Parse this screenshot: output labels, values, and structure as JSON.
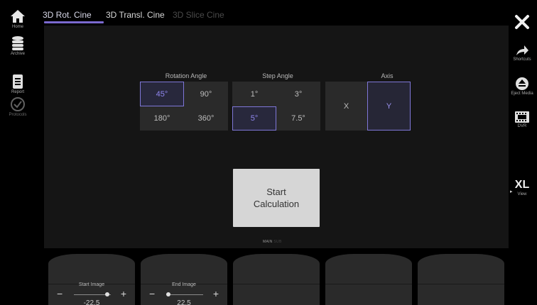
{
  "sidebar_left": {
    "home": "Home",
    "archive": "Archive",
    "report": "Report",
    "protocols": "Protocols"
  },
  "sidebar_right": {
    "shortcuts": "Shortcuts",
    "eject": "Eject Media",
    "dvr": "DVR",
    "xl": "XL",
    "view": "View"
  },
  "tabs": [
    {
      "label": "3D Rot. Cine",
      "state": "active"
    },
    {
      "label": "3D Transl. Cine",
      "state": "normal"
    },
    {
      "label": "3D Slice Cine",
      "state": "disabled"
    }
  ],
  "rotation": {
    "label": "Rotation Angle",
    "options": [
      "45°",
      "90°",
      "180°",
      "360°"
    ],
    "selected": "45°"
  },
  "step": {
    "label": "Step Angle",
    "options": [
      "1°",
      "3°",
      "5°",
      "7.5°"
    ],
    "selected": "5°"
  },
  "axis": {
    "label": "Axis",
    "options": [
      "X",
      "Y"
    ],
    "selected": "Y"
  },
  "start_calc": {
    "line1": "Start",
    "line2": "Calculation"
  },
  "page_indicator": {
    "main": "MAIN",
    "other": "SUB"
  },
  "knobs": [
    {
      "label": "Start Image",
      "value": "-22.5",
      "minus": "−",
      "plus": "+"
    },
    {
      "label": "End Image",
      "value": "22.5",
      "minus": "−",
      "plus": "+"
    }
  ],
  "colors": {
    "accent": "#7b6ad0",
    "panel": "#151515",
    "button": "#2a2a2a"
  }
}
